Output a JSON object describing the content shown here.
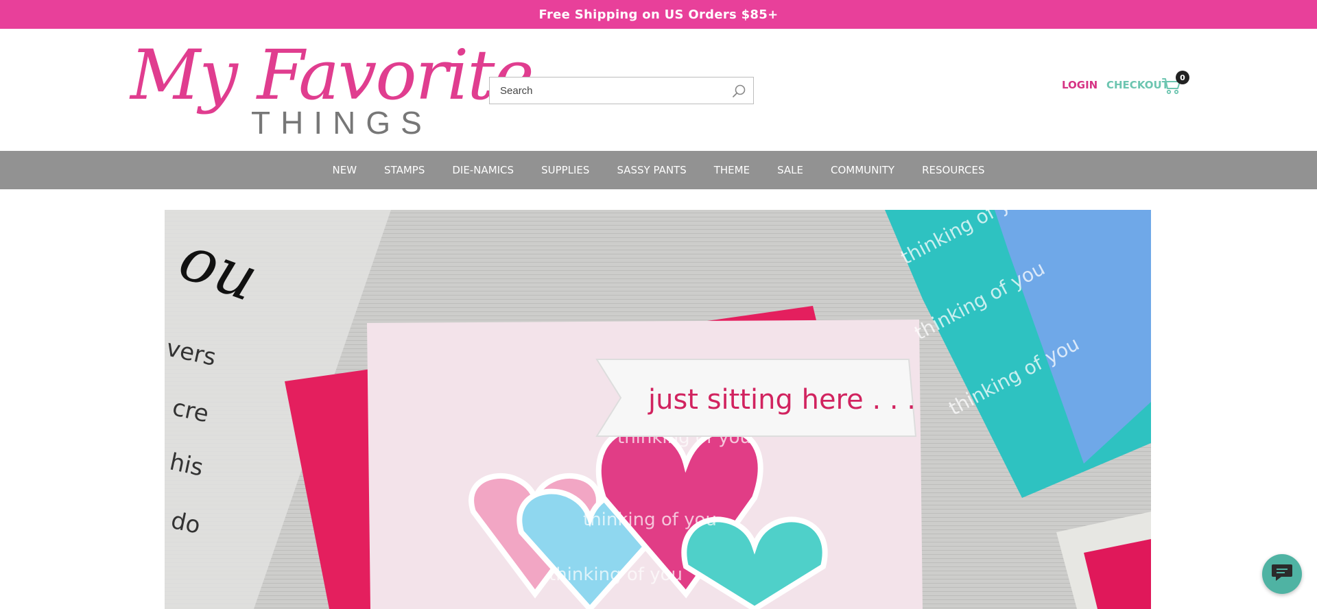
{
  "promo": {
    "text": "Free Shipping on US Orders $85+"
  },
  "brand": {
    "script": "My Favorite",
    "sub": "THINGS"
  },
  "search": {
    "placeholder": "Search"
  },
  "account": {
    "login_label": "LOGIN",
    "checkout_label": "CHECKOUT",
    "cart_count": "0"
  },
  "nav": {
    "items": [
      "NEW",
      "STAMPS",
      "DIE-NAMICS",
      "SUPPLIES",
      "SASSY PANTS",
      "THEME",
      "SALE",
      "COMMUNITY",
      "RESOURCES"
    ]
  },
  "hero": {
    "banner_text": "just sitting here . . .",
    "pattern_text": "thinking of you",
    "stamp_words": [
      "ou",
      "vers",
      "cre",
      "his",
      "do"
    ]
  },
  "colors": {
    "promo_bg": "#e8409a",
    "brand_pink": "#e03d8f",
    "login": "#d63384",
    "checkout": "#6cc5b0",
    "nav_bg": "#929292",
    "chat": "#4fb3a3"
  },
  "icons": {
    "search": "search-icon",
    "cart": "cart-icon",
    "chat": "chat-icon"
  }
}
